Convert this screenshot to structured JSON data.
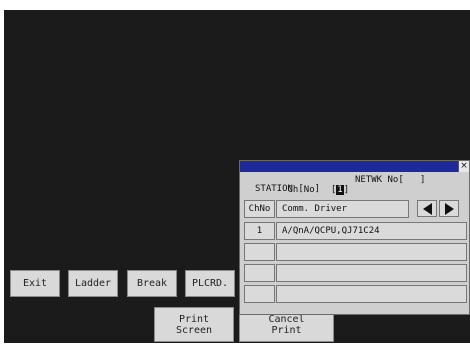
{
  "buttons": {
    "exit": "Exit",
    "ladder": "Ladder",
    "break": "Break",
    "plcrd": "PLCRD.",
    "print_screen": "Print\nScreen",
    "cancel_print": "Cancel\nPrint"
  },
  "dialog": {
    "close_symbol": "×",
    "ch_no_label": "Ch No",
    "ch_no_open": "[",
    "ch_no_value": "1",
    "ch_no_close": "]",
    "netwk_label": "NETWK No[   ]",
    "station_label": "STATION [  ]",
    "table": {
      "col_chno": "ChNo",
      "col_driver": "Comm. Driver",
      "rows": [
        {
          "ch": "1",
          "driver": "A/QnA/QCPU,QJ71C24"
        },
        {
          "ch": "",
          "driver": ""
        },
        {
          "ch": "",
          "driver": ""
        },
        {
          "ch": "",
          "driver": ""
        }
      ]
    }
  }
}
